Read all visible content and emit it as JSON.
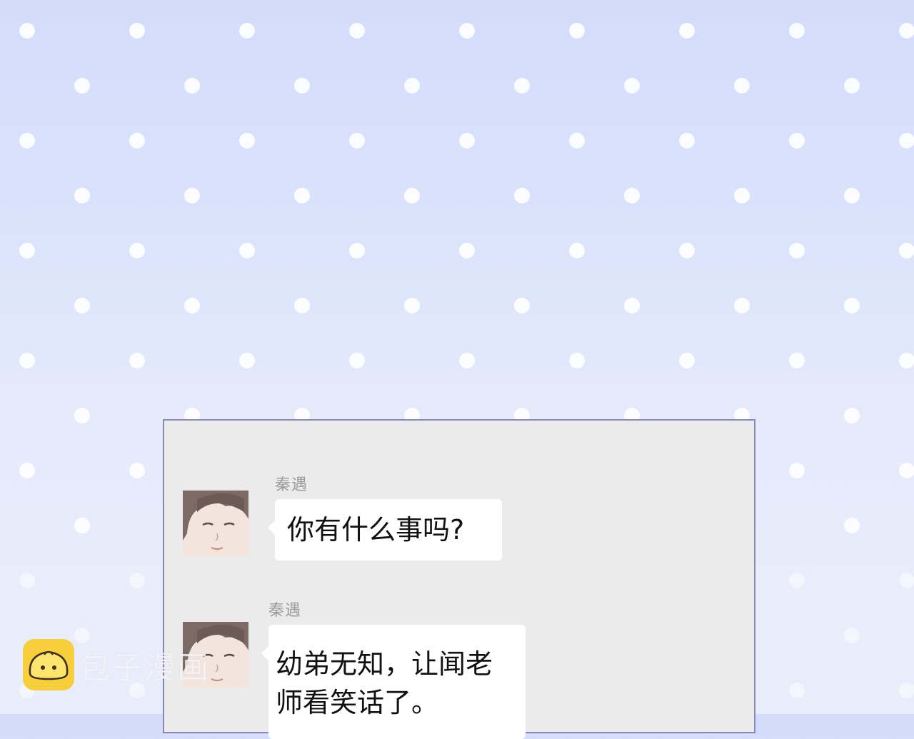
{
  "background": {
    "colors": {
      "top": "#d3dcfb",
      "bottom": "#e9ecfb",
      "dot": "#ffffff",
      "panel_border": "#8a86b6",
      "panel_bg": "#ebebeb"
    }
  },
  "messages": [
    {
      "sender": "秦遇",
      "text": "你有什么事吗?",
      "avatar": "qin-yu-avatar"
    },
    {
      "sender": "秦遇",
      "text_lines": [
        "幼弟无知，让闻老",
        "师看笑话了。"
      ],
      "avatar": "qin-yu-avatar"
    }
  ],
  "watermark": {
    "text": "包子漫画",
    "logo": "bun-mascot-icon",
    "logo_color": "#f7cf3c"
  }
}
